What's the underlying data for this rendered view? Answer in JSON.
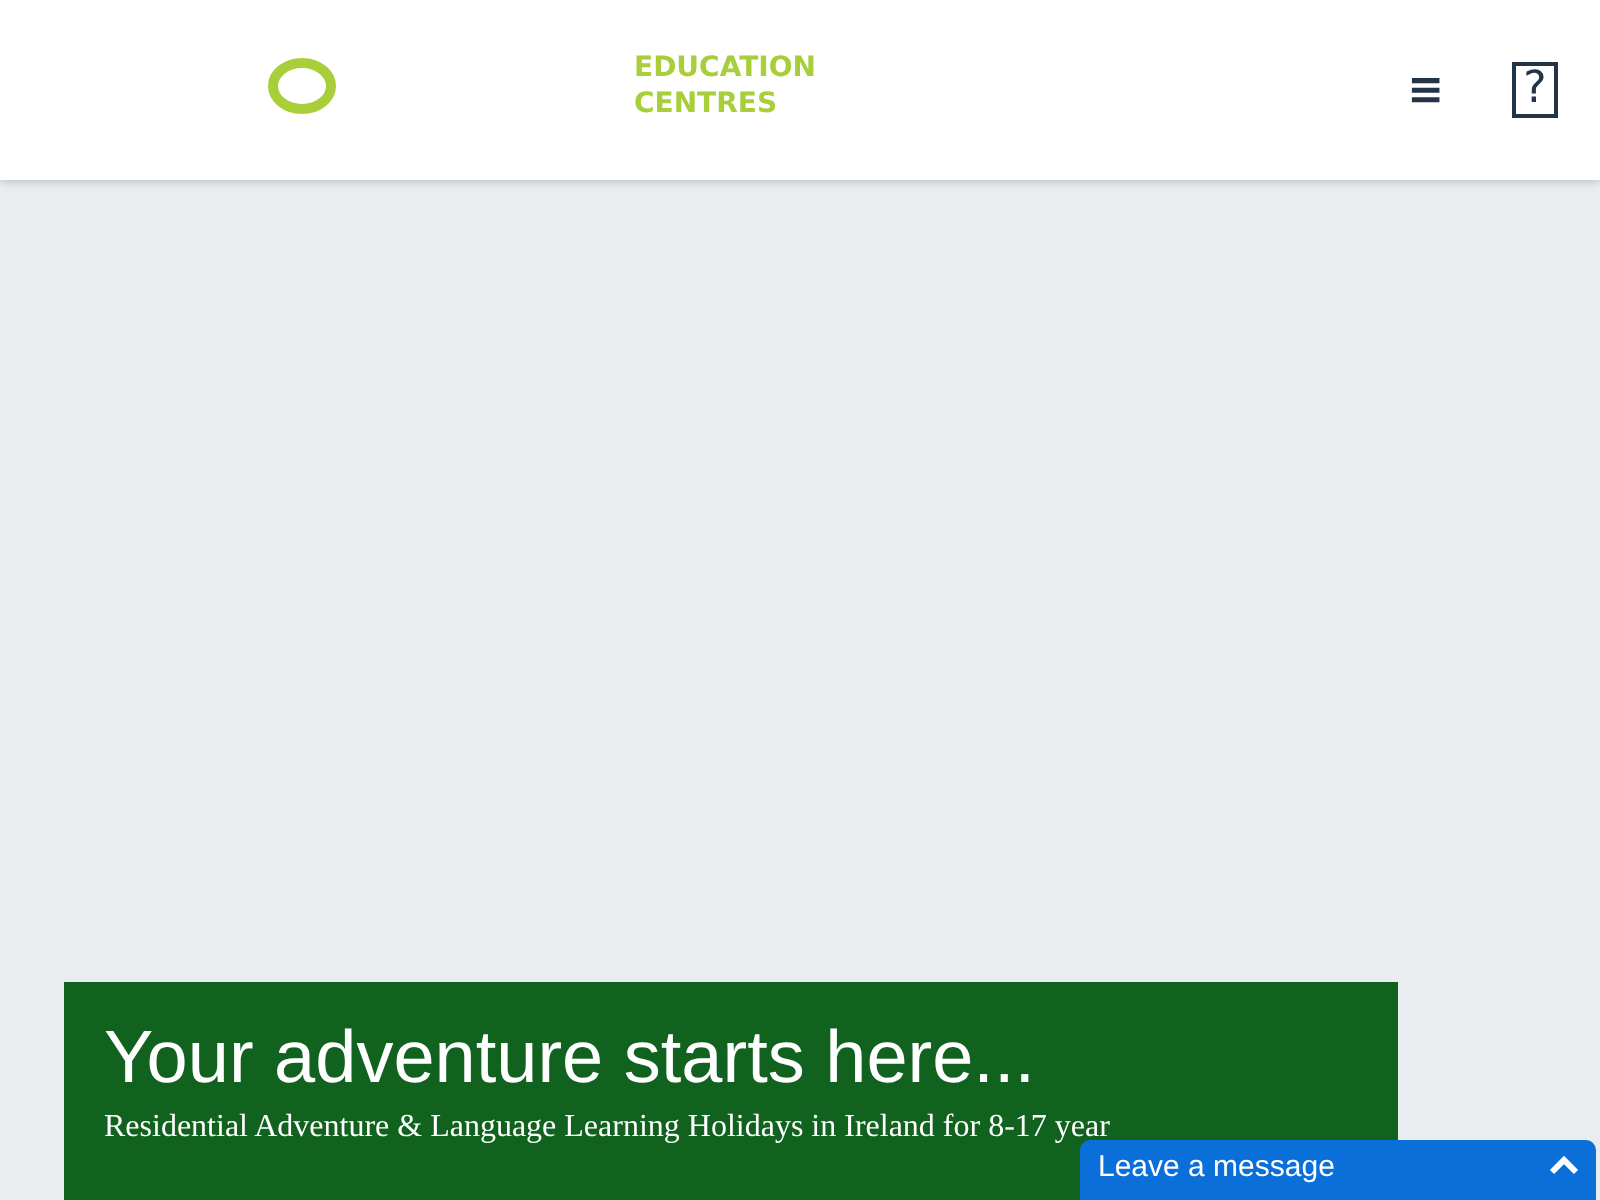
{
  "header": {
    "brand": [
      "EDUCATION",
      "CENTRES"
    ],
    "menu_icon": "≡",
    "help_icon": "?"
  },
  "hero": {
    "title": "Your adventure starts here...",
    "subtitle": "Residential Adventure & Language Learning Holidays in Ireland for 8-17 year"
  },
  "chat_widget": {
    "label": "Leave a message"
  }
}
